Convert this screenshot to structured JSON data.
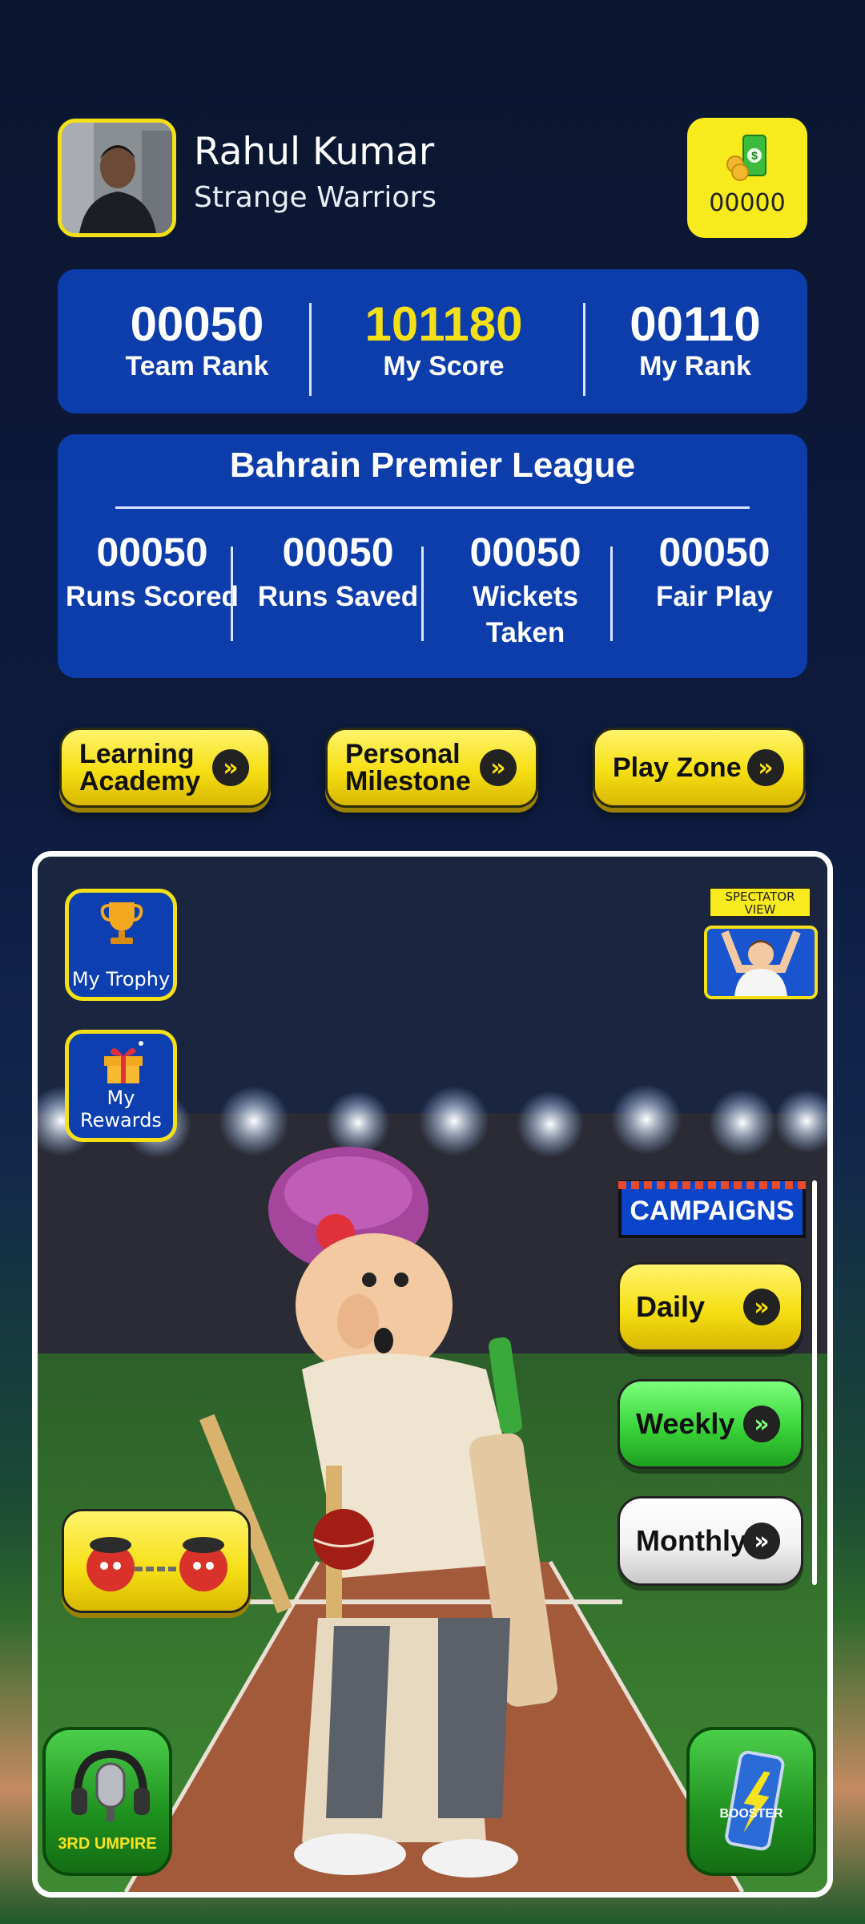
{
  "profile": {
    "name": "Rahul Kumar",
    "team": "Strange Warriors",
    "wallet_amount": "00000"
  },
  "summary": [
    {
      "value": "00050",
      "label": "Team Rank"
    },
    {
      "value": "101180",
      "label": "My Score"
    },
    {
      "value": "00110",
      "label": "My Rank"
    }
  ],
  "league": {
    "title": "Bahrain Premier League",
    "stats": [
      {
        "value": "00050",
        "label": "Runs Scored"
      },
      {
        "value": "00050",
        "label": "Runs Saved"
      },
      {
        "value": "00050",
        "label": "Wickets Taken"
      },
      {
        "value": "00050",
        "label": "Fair Play"
      }
    ]
  },
  "actions": {
    "learning": "Learning Academy",
    "milestone": "Personal Milestone",
    "playzone": "Play Zone"
  },
  "scene": {
    "trophy": "My Trophy",
    "rewards": "My Rewards",
    "spectator": "SPECTATOR VIEW",
    "campaigns": "CAMPAIGNS",
    "daily": "Daily",
    "weekly": "Weekly",
    "monthly": "Monthly",
    "umpire": "3RD UMPIRE",
    "booster": "BOOSTER"
  },
  "colors": {
    "accent_yellow": "#f6df14",
    "card_blue": "#0c3dab",
    "score_yellow": "#f4e017",
    "weekly_green": "#3ad43a",
    "monthly_white": "#f2f2f2"
  },
  "icons": [
    "trophy-icon",
    "gift-icon",
    "money-icon",
    "chevron-right-icon",
    "microphone-icon",
    "energy-can-icon"
  ]
}
